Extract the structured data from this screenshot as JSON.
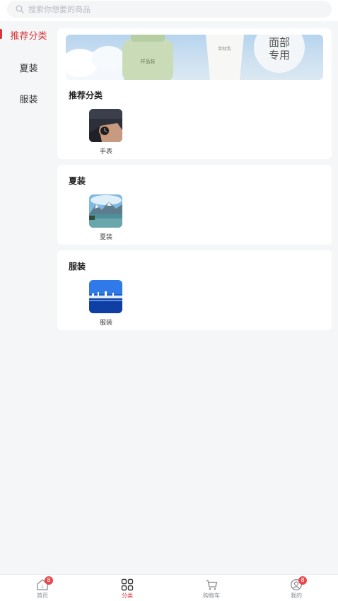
{
  "search": {
    "placeholder": "搜索你想要的商品"
  },
  "sidebar": {
    "items": [
      {
        "label": "推荐分类",
        "active": true
      },
      {
        "label": "夏装",
        "active": false
      },
      {
        "label": "服装",
        "active": false
      }
    ]
  },
  "sections": [
    {
      "title": "推荐分类",
      "items": [
        {
          "label": "手表",
          "image": "watch-photo"
        }
      ]
    },
    {
      "title": "夏装",
      "items": [
        {
          "label": "夏装",
          "image": "lake-mountain-photo"
        }
      ]
    },
    {
      "title": "服装",
      "items": [
        {
          "label": "服装",
          "image": "city-night-photo"
        }
      ]
    }
  ],
  "banner": {
    "text": "面部\n专用",
    "bottle_text": "样品装",
    "tube_text": "卸妆乳"
  },
  "tabbar": {
    "items": [
      {
        "label": "首页",
        "icon": "home-icon",
        "badge": "8",
        "active": false
      },
      {
        "label": "分类",
        "icon": "category-grid-icon",
        "badge": "",
        "active": true
      },
      {
        "label": "购物车",
        "icon": "cart-icon",
        "badge": "",
        "active": false
      },
      {
        "label": "我的",
        "icon": "user-icon",
        "badge": "8",
        "active": false
      }
    ]
  },
  "colors": {
    "accent": "#d4363a",
    "badge": "#e8484c",
    "background": "#f5f6f8"
  }
}
